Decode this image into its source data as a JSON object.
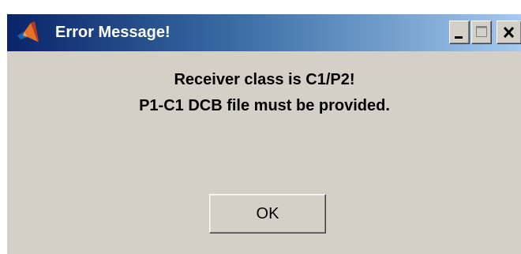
{
  "window": {
    "title": "Error Message!",
    "icon": "matlab-logo-icon",
    "controls": {
      "minimize_icon": "minimize-icon",
      "maximize_icon": "maximize-icon",
      "close_icon": "close-icon"
    }
  },
  "message": {
    "line1": "Receiver class is C1/P2!",
    "line2": "P1-C1 DCB file must be provided."
  },
  "buttons": {
    "ok_label": "OK"
  },
  "colors": {
    "titlebar_start": "#0a246a",
    "titlebar_end": "#a6caf0",
    "dialog_background": "#d4d0c8",
    "text": "#000000"
  }
}
